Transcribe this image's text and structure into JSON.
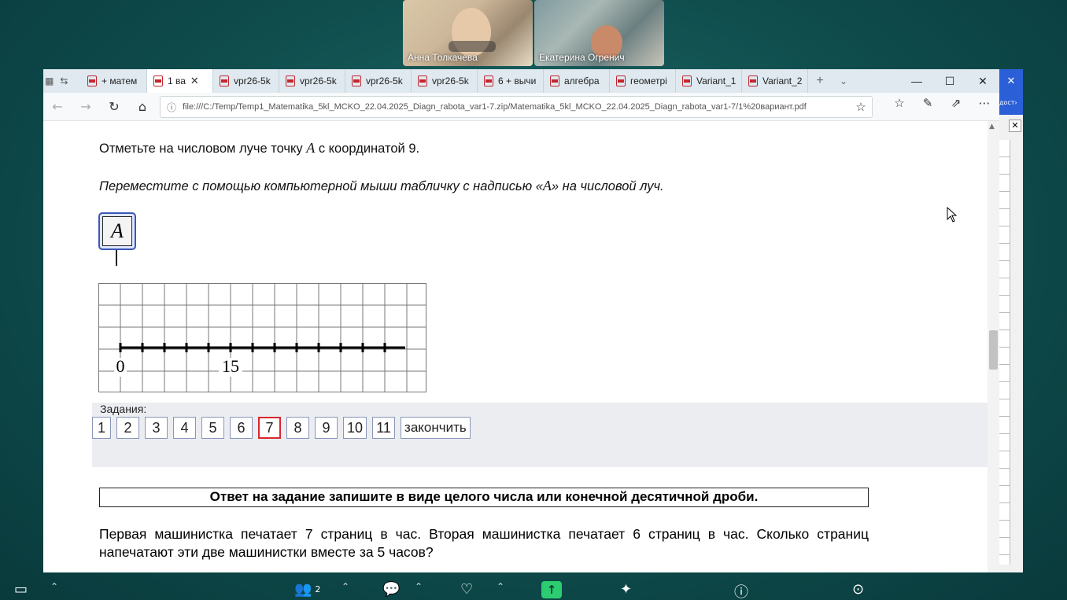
{
  "participants": [
    {
      "name": "Анна Толкачева"
    },
    {
      "name": "Екатерина Огренич"
    }
  ],
  "browser": {
    "tabs": [
      {
        "label": "+ матем",
        "active": false
      },
      {
        "label": "1 ва",
        "active": true
      },
      {
        "label": "vpr26-5k",
        "active": false
      },
      {
        "label": "vpr26-5k",
        "active": false
      },
      {
        "label": "vpr26-5k",
        "active": false
      },
      {
        "label": "vpr26-5k",
        "active": false
      },
      {
        "label": "6 + вычи",
        "active": false
      },
      {
        "label": "алгебра",
        "active": false
      },
      {
        "label": "геометрі",
        "active": false
      },
      {
        "label": "Variant_1",
        "active": false
      },
      {
        "label": "Variant_2",
        "active": false
      }
    ],
    "url": "file:///C:/Temp/Temp1_Matematika_5kl_MCKO_22.04.2025_Diagn_rabota_var1-7.zip/Matematika_5kl_MCKO_22.04.2025_Diagn_rabota_var1-7/1%20вариант.pdf"
  },
  "question": {
    "line1_before": "Отметьте на числовом луче точку ",
    "point": "A",
    "line1_after": " с координатой 9.",
    "instruction_before": "Переместите с помощью компьютерной мыши табличку с надписью «",
    "instruction_after": "» на числовой луч.",
    "label_letter": "A",
    "axis_labels": {
      "zero": "0",
      "marked": "15"
    }
  },
  "tasks": {
    "label": "Задания:",
    "items": [
      "1",
      "2",
      "3",
      "4",
      "5",
      "6",
      "7",
      "8",
      "9",
      "10",
      "11"
    ],
    "current": "7",
    "finish_label": "закончить"
  },
  "next_task": {
    "instruction": "Ответ на задание запишите в виде целого числа или конечной десятичной дроби.",
    "problem": "Первая машинистка печатает 7 страниц в час. Вторая машинистка печатает 6 страниц в час. Сколько страниц напечатают эти две машинистки вместе за 5 часов?"
  },
  "side_panel": {
    "text": "дост"
  },
  "meeting_bar": {
    "participants_count": "2"
  },
  "colors": {
    "accent_green": "#2ecc71",
    "current_task_border": "#d8262e",
    "label_border": "#3a57b8"
  }
}
